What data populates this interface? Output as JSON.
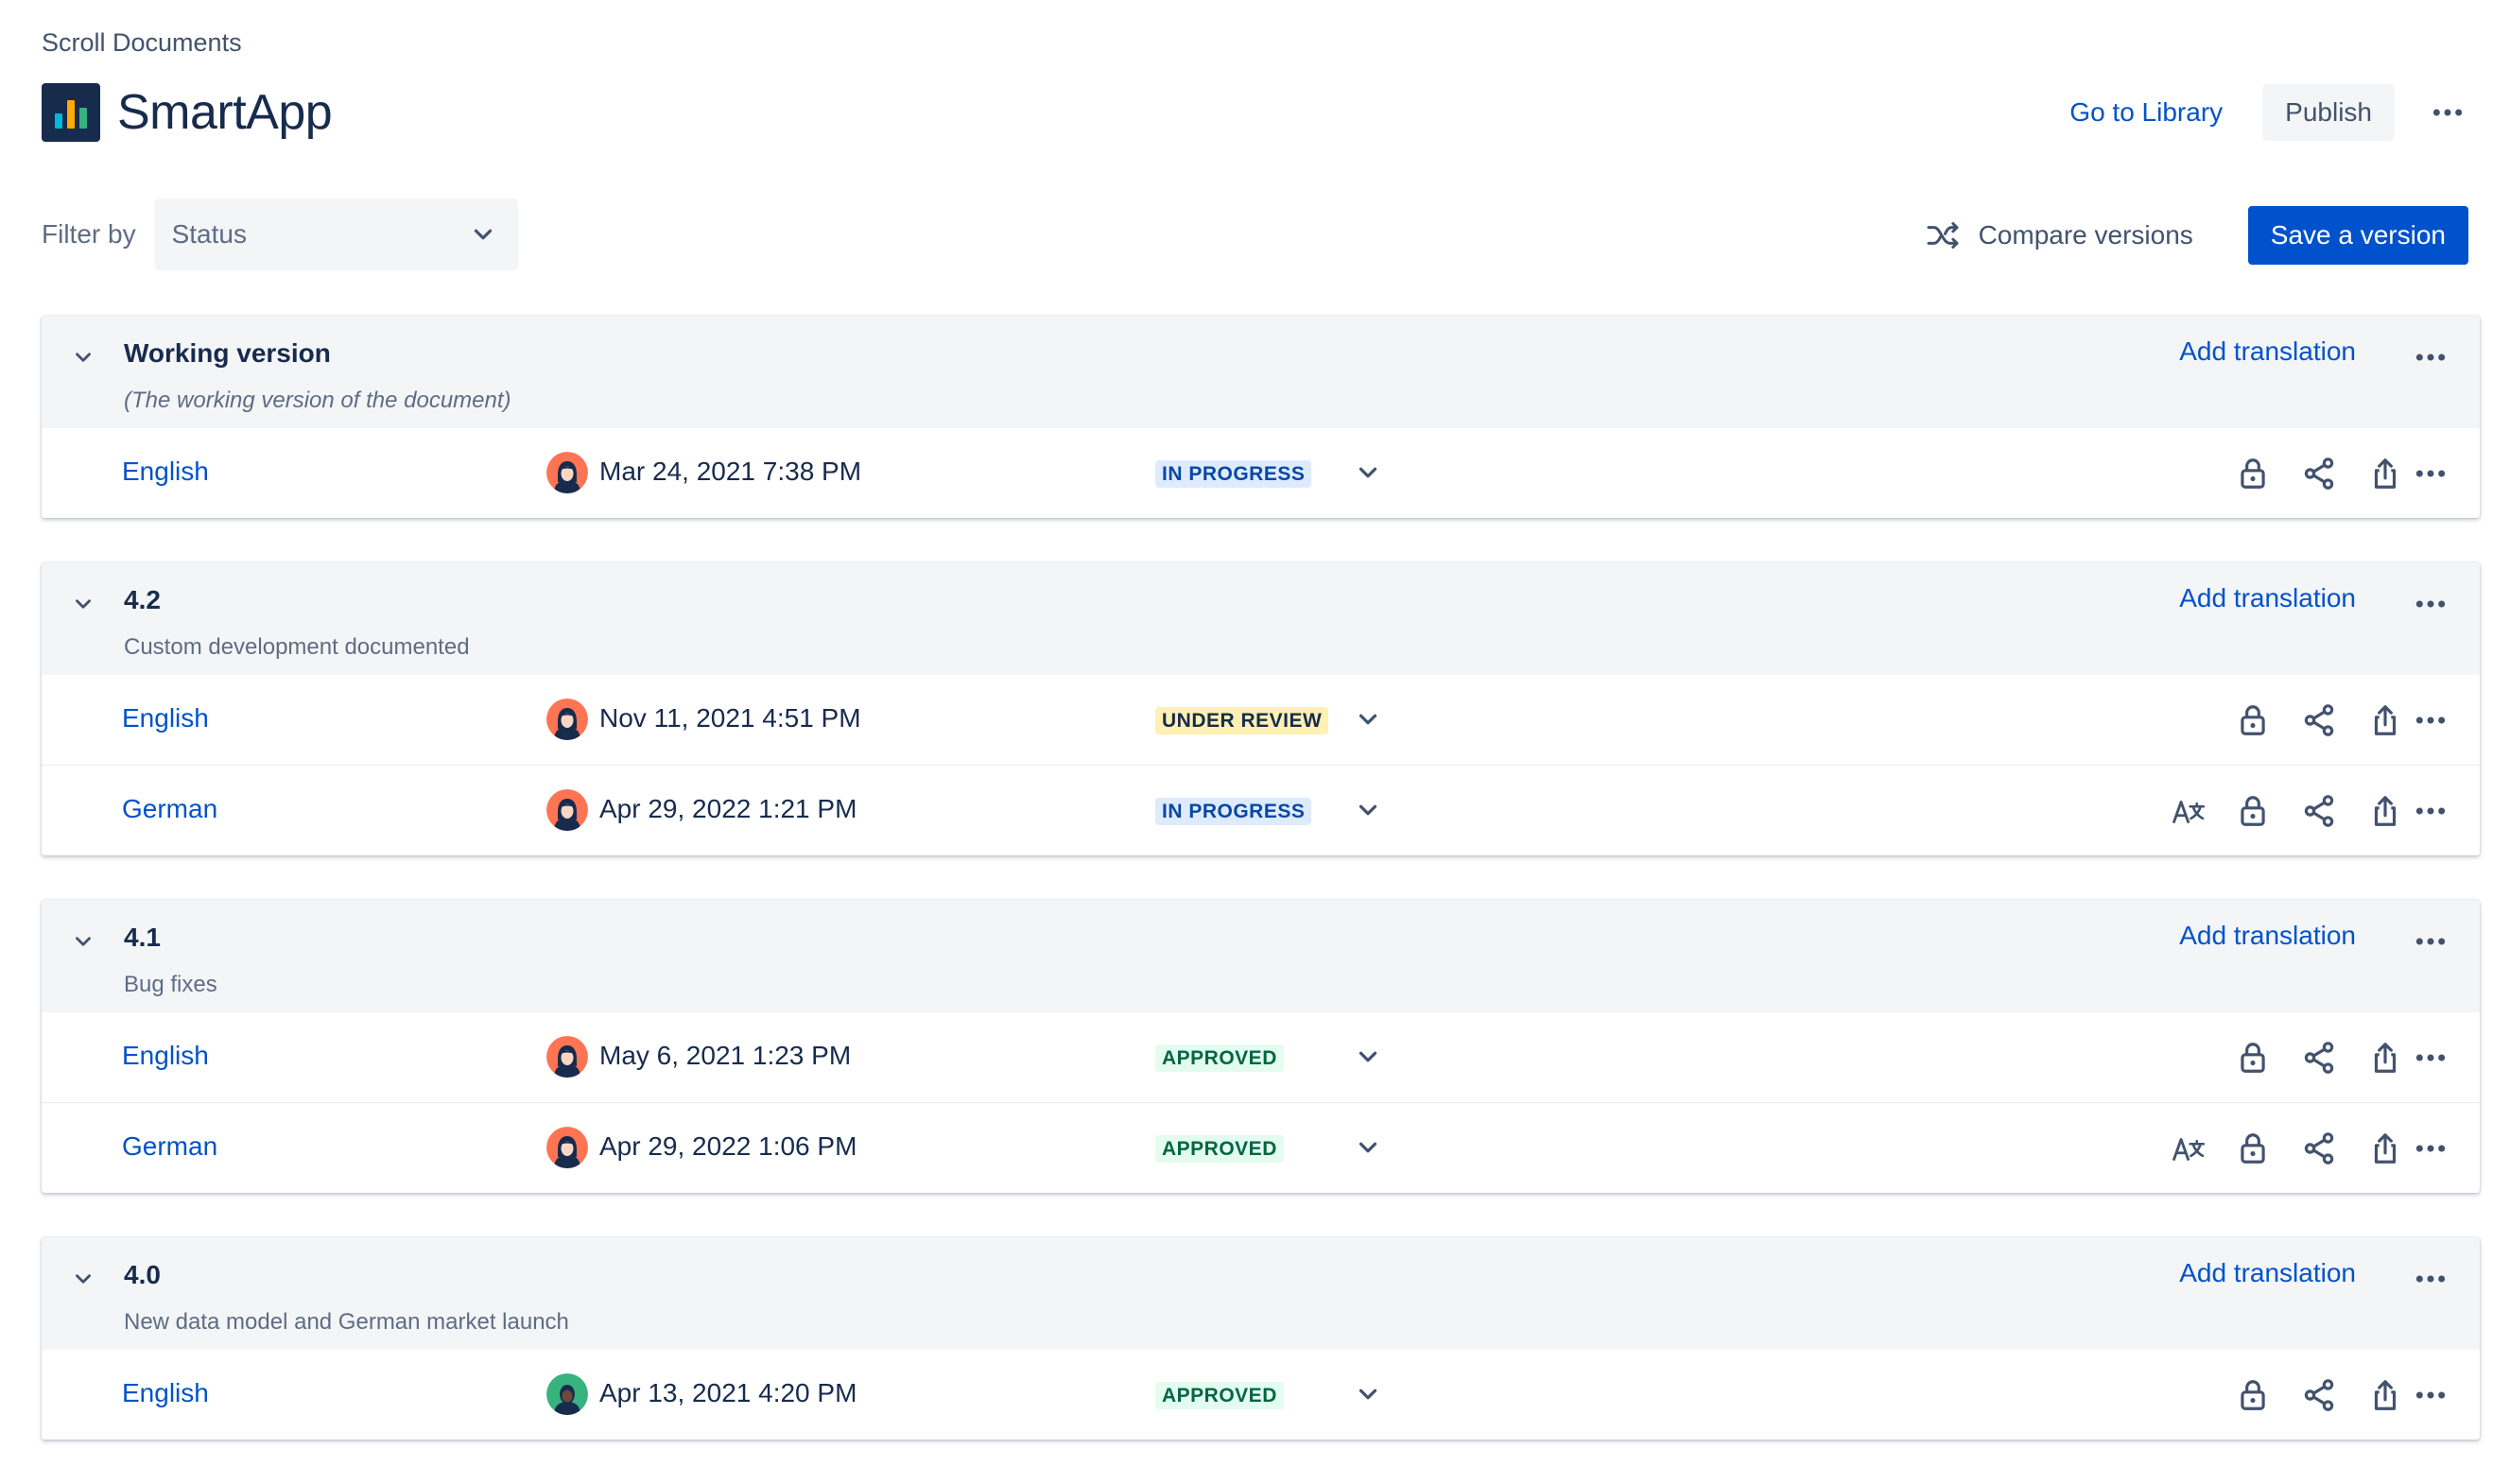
{
  "breadcrumb": "Scroll Documents",
  "app": {
    "title": "SmartApp",
    "logo_colors": [
      "#ffab00",
      "#00b8d9",
      "#36b37e"
    ]
  },
  "header": {
    "go_to_library": "Go to Library",
    "publish": "Publish",
    "more_icon": "more-horizontal-icon"
  },
  "filter": {
    "label": "Filter by",
    "placeholder": "Status"
  },
  "toolbar": {
    "compare": "Compare versions",
    "save": "Save a version"
  },
  "colors": {
    "primary": "#0052cc",
    "text": "#172b4d",
    "subtle": "#5e6c84",
    "panel": "#f4f5f7"
  },
  "versions": [
    {
      "name": "Working version",
      "description": "(The working version of the document)",
      "add_translation": "Add translation",
      "rows": [
        {
          "language": "English",
          "date": "Mar 24, 2021 7:38 PM",
          "status": "IN PROGRESS"
        }
      ]
    },
    {
      "name": "4.2",
      "description": "Custom development documented",
      "add_translation": "Add translation",
      "rows": [
        {
          "language": "English",
          "date": "Nov 11, 2021 4:51 PM",
          "status": "UNDER REVIEW"
        },
        {
          "language": "German",
          "date": "Apr 29, 2022 1:21 PM",
          "status": "IN PROGRESS"
        }
      ]
    },
    {
      "name": "4.1",
      "description": "Bug fixes",
      "add_translation": "Add translation",
      "rows": [
        {
          "language": "English",
          "date": "May 6, 2021 1:23 PM",
          "status": "APPROVED"
        },
        {
          "language": "German",
          "date": "Apr 29, 2022 1:06 PM",
          "status": "APPROVED"
        }
      ]
    },
    {
      "name": "4.0",
      "description": "New data model and German market launch",
      "add_translation": "Add translation",
      "rows": [
        {
          "language": "English",
          "date": "Apr 13, 2021 4:20 PM",
          "status": "APPROVED"
        }
      ]
    }
  ]
}
